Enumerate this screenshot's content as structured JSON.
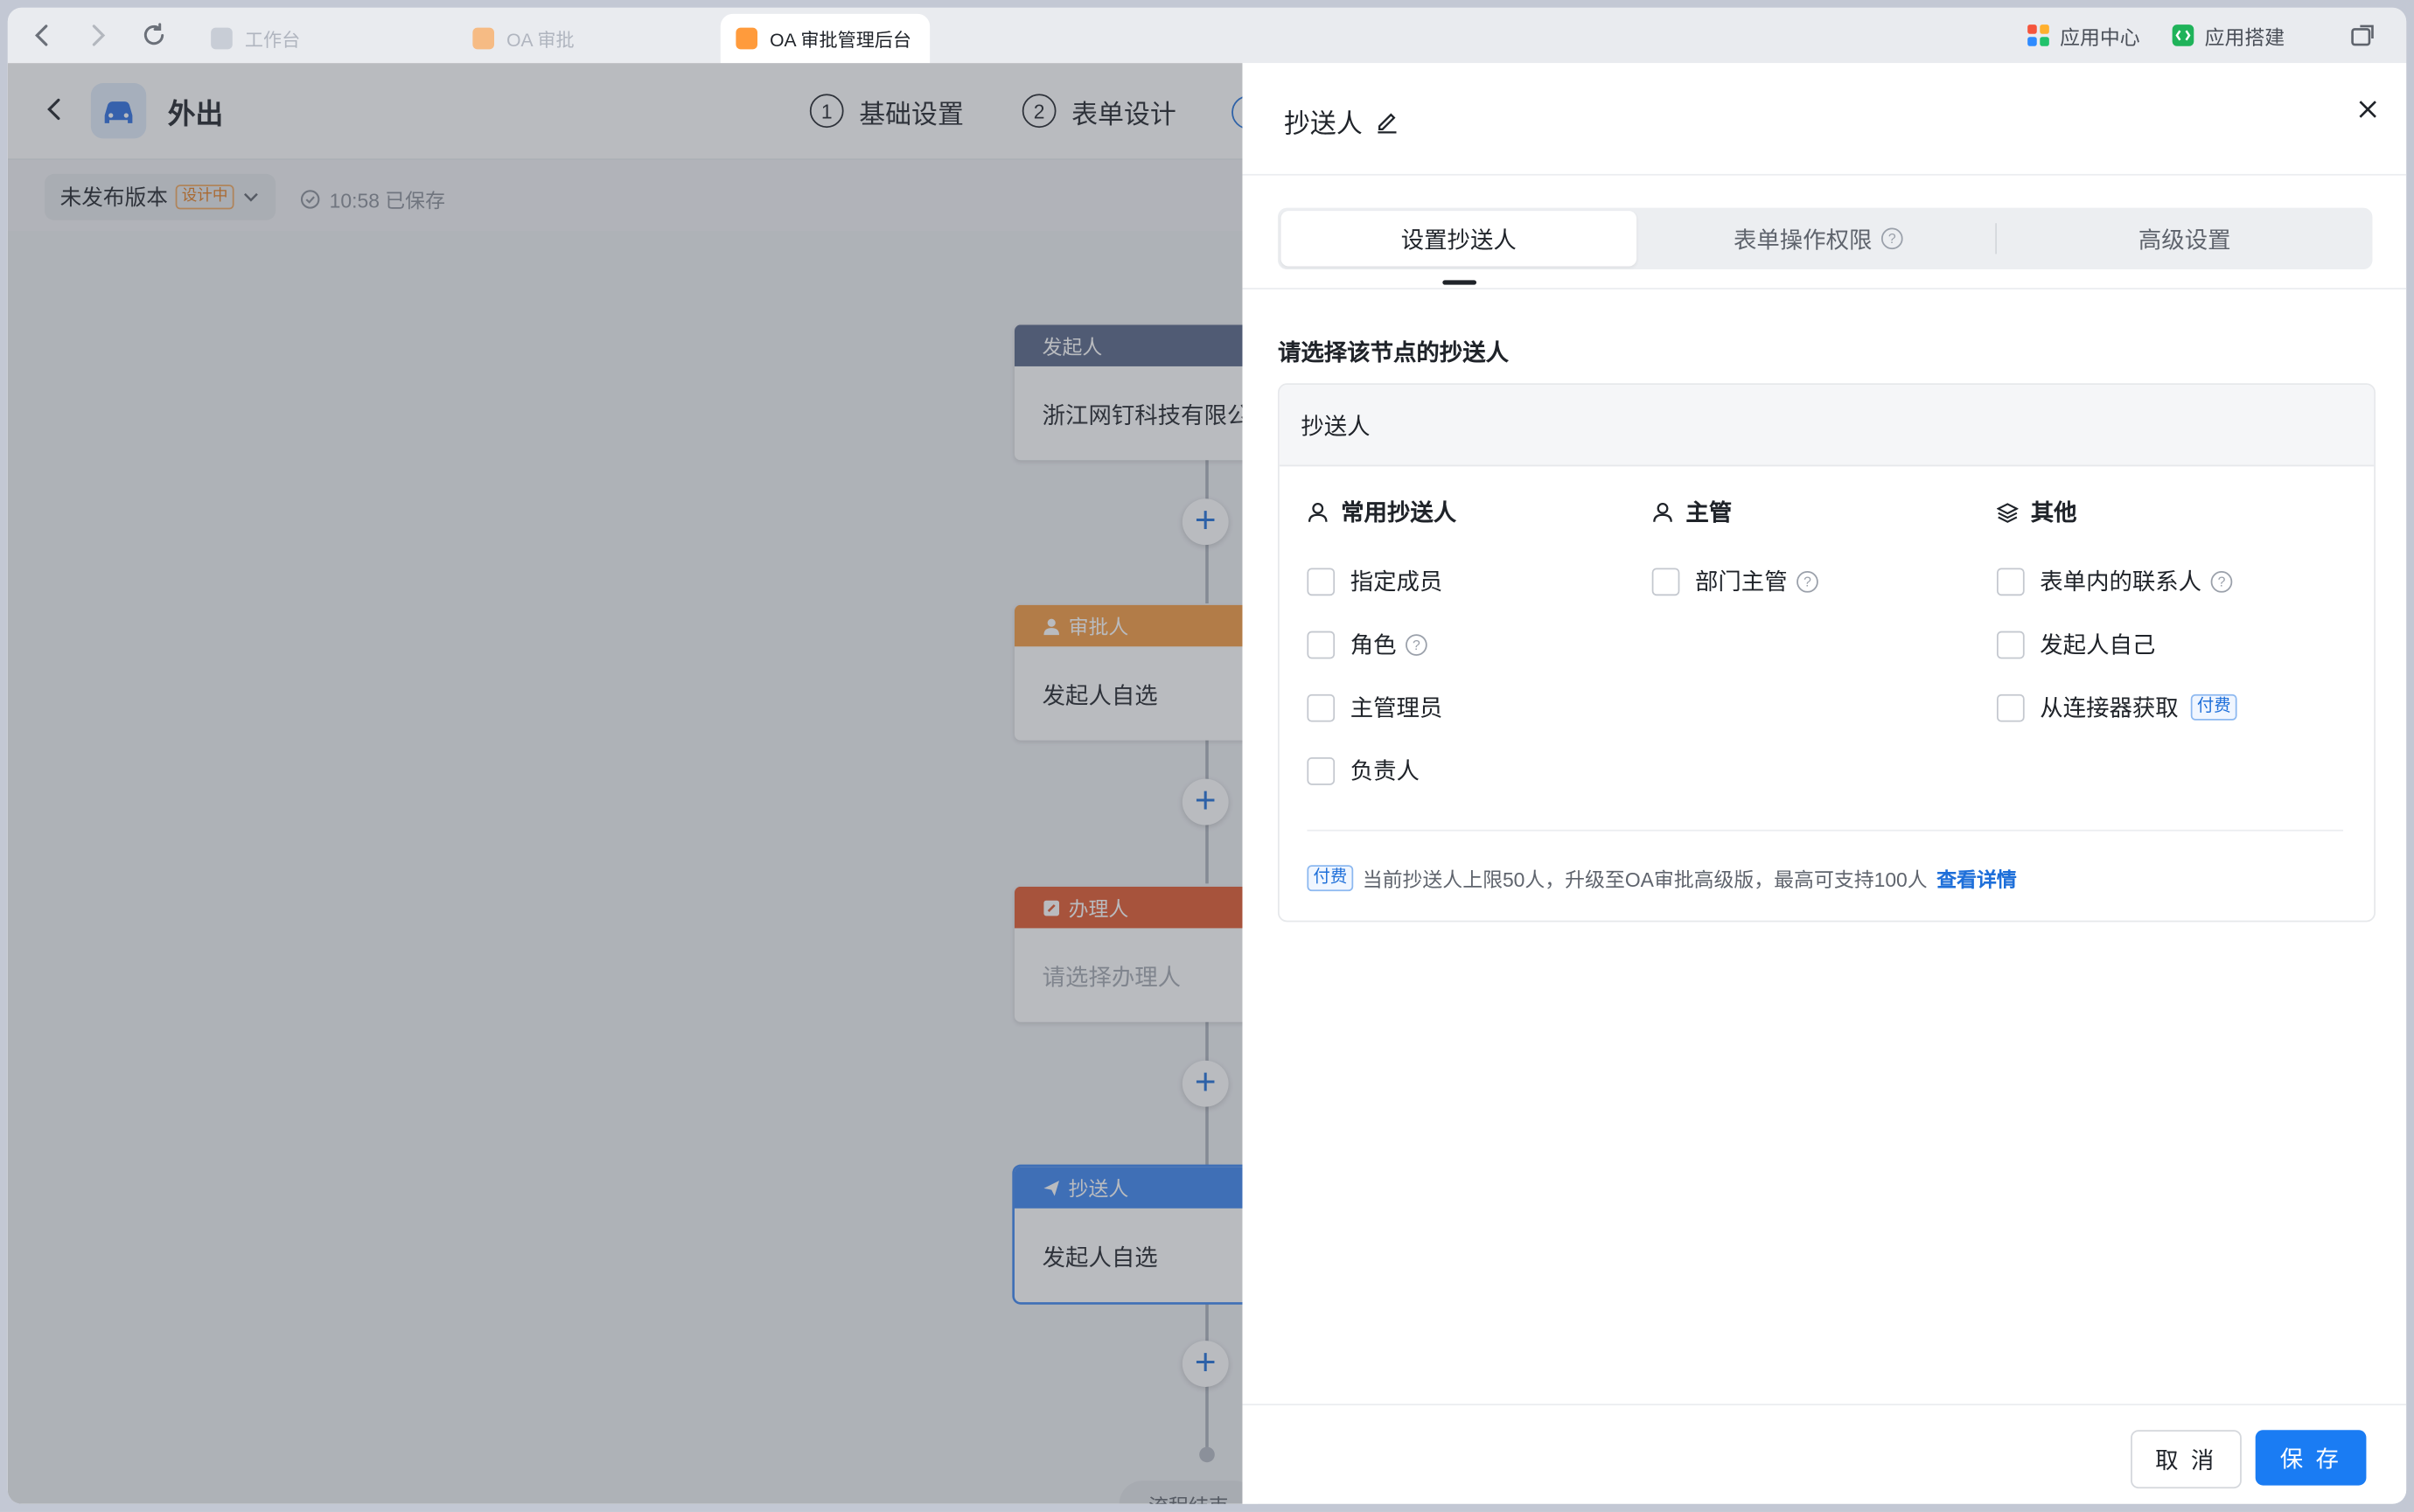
{
  "browser": {
    "tabs": [
      {
        "label": "工作台",
        "active": false
      },
      {
        "label": "OA 审批",
        "active": false
      },
      {
        "label": "OA 审批管理后台",
        "active": true
      }
    ],
    "app_center": "应用中心",
    "app_builder": "应用搭建"
  },
  "header": {
    "title": "外出",
    "steps": [
      {
        "num": "1",
        "label": "基础设置"
      },
      {
        "num": "2",
        "label": "表单设计"
      }
    ],
    "version_label": "未发布版本",
    "version_status": "设计中",
    "save_status": "10:58 已保存"
  },
  "flow": {
    "nodes": [
      {
        "title": "发起人",
        "content": "浙江网钉科技有限公",
        "color": "#566486"
      },
      {
        "title": "审批人",
        "content": "发起人自选",
        "color": "#f49a3f"
      },
      {
        "title": "办理人",
        "content": "请选择办理人",
        "color": "#e2572c"
      },
      {
        "title": "抄送人",
        "content": "发起人自选",
        "color": "#3a85f0"
      }
    ],
    "end_label": "流程结束"
  },
  "drawer": {
    "title": "抄送人",
    "tabs": [
      "设置抄送人",
      "表单操作权限",
      "高级设置"
    ],
    "prompt": "请选择该节点的抄送人",
    "card_title": "抄送人",
    "columns": [
      {
        "title": "常用抄送人",
        "icon": "user-icon",
        "options": [
          "指定成员",
          "角色",
          "主管理员",
          "负责人"
        ]
      },
      {
        "title": "主管",
        "icon": "user-icon",
        "options": [
          "部门主管"
        ]
      },
      {
        "title": "其他",
        "icon": "layers-icon",
        "options": [
          "表单内的联系人",
          "发起人自己",
          "从连接器获取"
        ]
      }
    ],
    "paid_badge": "付费",
    "notice": "当前抄送人上限50人，升级至OA审批高级版，最高可支持100人",
    "notice_link": "查看详情",
    "cancel": "取 消",
    "save": "保 存"
  }
}
